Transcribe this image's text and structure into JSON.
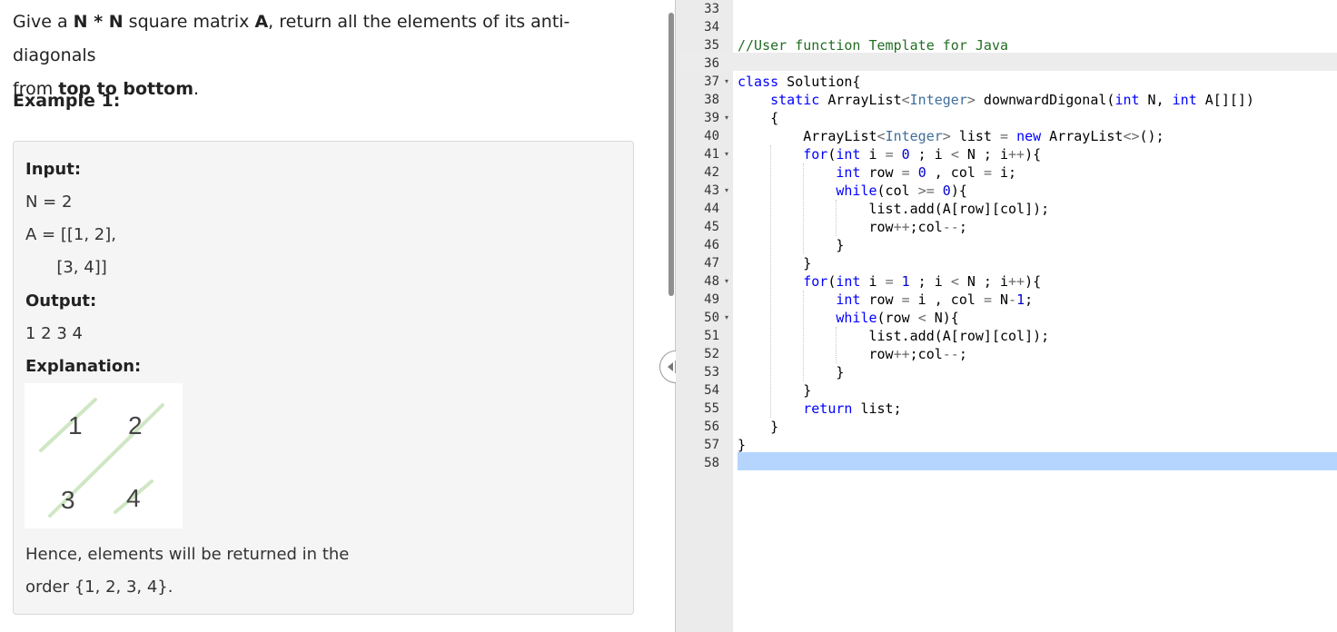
{
  "problem": {
    "intro_give": "Give a ",
    "intro_nn": "N * N",
    "intro_mid": " square matrix ",
    "intro_a": "A",
    "intro_rest": ", return all the elements of its anti-diagonals",
    "intro_from": "from ",
    "intro_ttb": "top to bottom",
    "intro_period": ".",
    "example_title": "Example 1:",
    "input_label": "Input:",
    "input_n": "N = 2",
    "input_a1": "A = [[1, 2],",
    "input_a2": "      [3, 4]]",
    "output_label": "Output:",
    "output_value": "1 2 3 4",
    "explanation_label": "Explanation:",
    "matrix": [
      "1",
      "2",
      "3",
      "4"
    ],
    "hence_1": "Hence, elements will be returned in the",
    "hence_2": "order {1, 2, 3, 4}."
  },
  "editor": {
    "first_line": 33,
    "active_line": 36,
    "selected_line": 58,
    "fold_lines": [
      37,
      39,
      41,
      43,
      48,
      50
    ],
    "lines": [
      "",
      "",
      "//User function Template for Java",
      "",
      "class Solution{",
      "    static ArrayList<Integer> downwardDigonal(int N, int A[][])",
      "    {",
      "        ArrayList<Integer> list = new ArrayList<>();",
      "        for(int i = 0 ; i < N ; i++){",
      "            int row = 0 , col = i;",
      "            while(col >= 0){",
      "                list.add(A[row][col]);",
      "                row++;col--;",
      "            }",
      "        }",
      "        for(int i = 1 ; i < N ; i++){",
      "            int row = i , col = N-1;",
      "            while(row < N){",
      "                list.add(A[row][col]);",
      "                row++;col--;",
      "            }",
      "        }",
      "        return list;",
      "    }",
      "}",
      ""
    ]
  },
  "colors": {
    "keyword": "#0000ff",
    "comment": "#236e24",
    "number": "#0000cd",
    "type": "#3f6e9a",
    "selection": "#b5d5ff"
  }
}
